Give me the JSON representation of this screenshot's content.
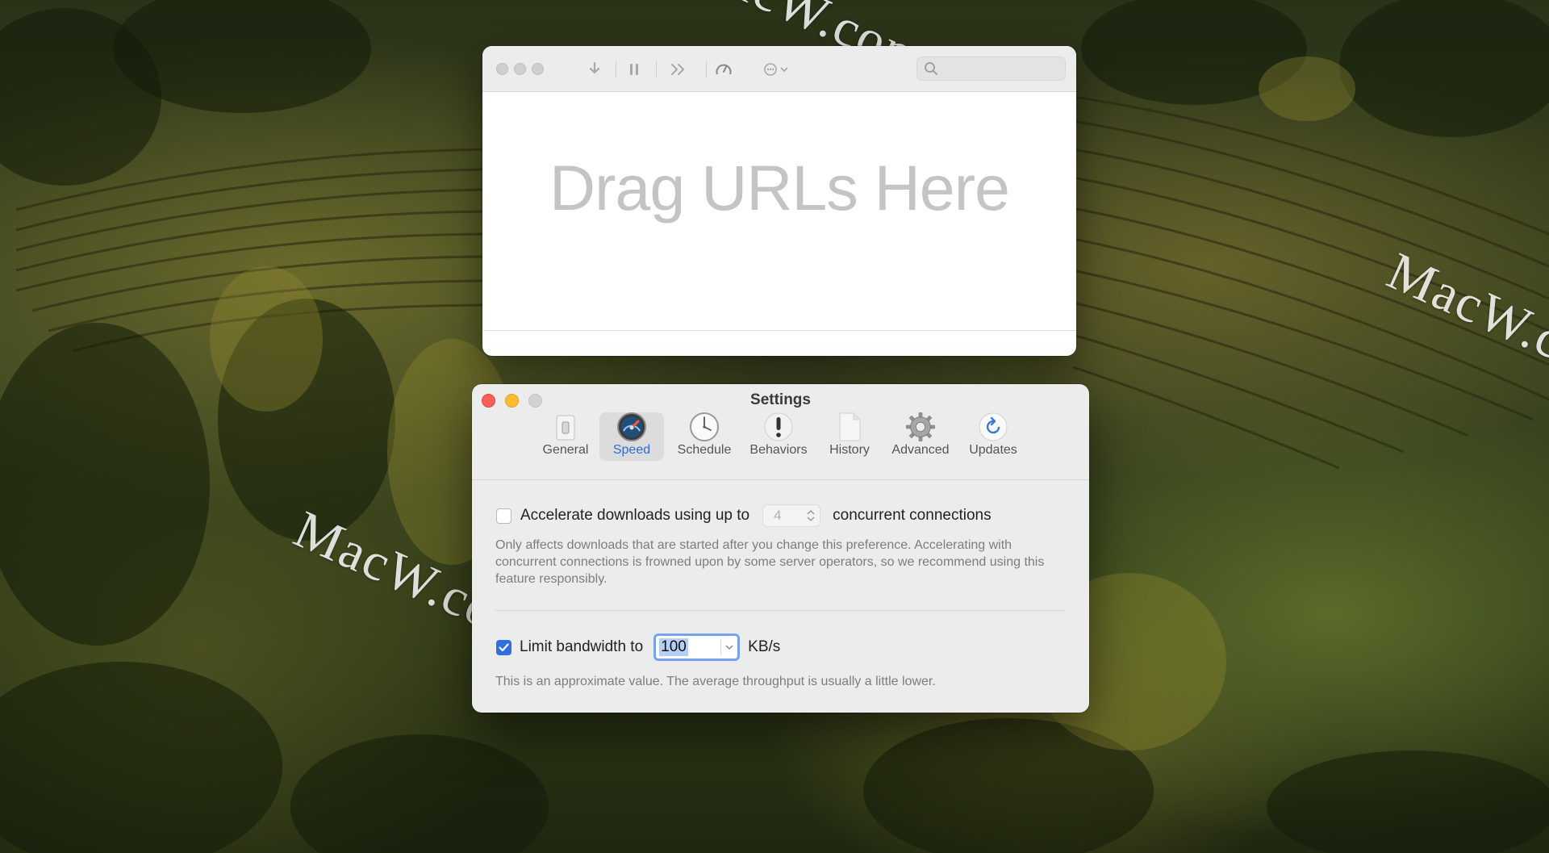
{
  "watermarks": [
    "MacW.com",
    "MacW.com",
    "MacW.com"
  ],
  "main_window": {
    "toolbar": {
      "icons": [
        "download-icon",
        "pause-icon",
        "fast-forward-icon",
        "speedometer-icon",
        "more-menu-icon",
        "search-icon"
      ],
      "search_placeholder": ""
    },
    "drop_text": "Drag URLs Here"
  },
  "settings": {
    "title": "Settings",
    "tabs": [
      {
        "label": "General",
        "icon": "switch-icon"
      },
      {
        "label": "Speed",
        "icon": "speedometer-icon",
        "selected": true
      },
      {
        "label": "Schedule",
        "icon": "clock-icon"
      },
      {
        "label": "Behaviors",
        "icon": "exclamation-icon"
      },
      {
        "label": "History",
        "icon": "document-icon"
      },
      {
        "label": "Advanced",
        "icon": "gear-icon"
      },
      {
        "label": "Updates",
        "icon": "refresh-icon"
      }
    ],
    "accelerate": {
      "checked": false,
      "label_before": "Accelerate downloads using up to",
      "connections_value": "4",
      "label_after": "concurrent connections",
      "note": "Only affects downloads that are started after you change this preference. Accelerating with concurrent connections is frowned upon by some server operators, so we recommend using this feature responsibly."
    },
    "bandwidth": {
      "checked": true,
      "label": "Limit bandwidth to",
      "value": "100",
      "unit": "KB/s",
      "note": "This is an approximate value. The average throughput is usually a little lower."
    }
  },
  "colors": {
    "accent": "#2f6fe0",
    "close": "#ff5f57",
    "minimize": "#febc2e",
    "zoom_inactive": "#cfcfcf"
  }
}
